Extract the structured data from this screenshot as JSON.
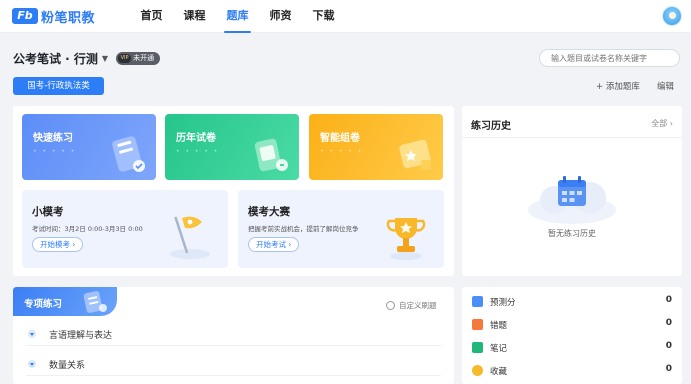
{
  "brand": {
    "mark": "Fb",
    "name": "粉笔职教",
    "color": "#2d7df6"
  },
  "nav": [
    {
      "label": "首页",
      "active": false
    },
    {
      "label": "课程",
      "active": false
    },
    {
      "label": "题库",
      "active": true
    },
    {
      "label": "师资",
      "active": false
    },
    {
      "label": "下载",
      "active": false
    }
  ],
  "subject": {
    "title": "公考笔试 · 行测",
    "badge_vip": "VIP",
    "badge_label": "未开通"
  },
  "search": {
    "placeholder": "输入题目或试卷名称关键字"
  },
  "category": "国考-行政执法类",
  "actions": {
    "add_bank": "+ 添加题库",
    "edit": "编辑"
  },
  "cards": [
    {
      "title": "快速练习",
      "icon": "quick-practice-icon"
    },
    {
      "title": "历年试卷",
      "icon": "past-papers-icon"
    },
    {
      "title": "智能组卷",
      "icon": "smart-paper-icon"
    }
  ],
  "mock_small": {
    "title": "小模考",
    "subtitle": "考试时间：3月2日 0:00-3月3日 0:00",
    "button": "开始模考 ›"
  },
  "mock_big": {
    "title": "模考大赛",
    "subtitle": "把握考前实战机会，提前了解岗位竞争",
    "button": "开始考试 ›"
  },
  "history": {
    "title": "练习历史",
    "all": "全部 ›",
    "empty": "暂无练习历史"
  },
  "special": {
    "title": "专项练习",
    "custom_refresh": "自定义刷题",
    "topics": [
      "言语理解与表达",
      "数量关系"
    ]
  },
  "stats": [
    {
      "label": "预测分",
      "value": "0",
      "color": "#4c8ef7"
    },
    {
      "label": "错题",
      "value": "0",
      "color": "#f5793b"
    },
    {
      "label": "笔记",
      "value": "0",
      "color": "#21b77a"
    },
    {
      "label": "收藏",
      "value": "0",
      "color": "#f7b92b"
    }
  ]
}
